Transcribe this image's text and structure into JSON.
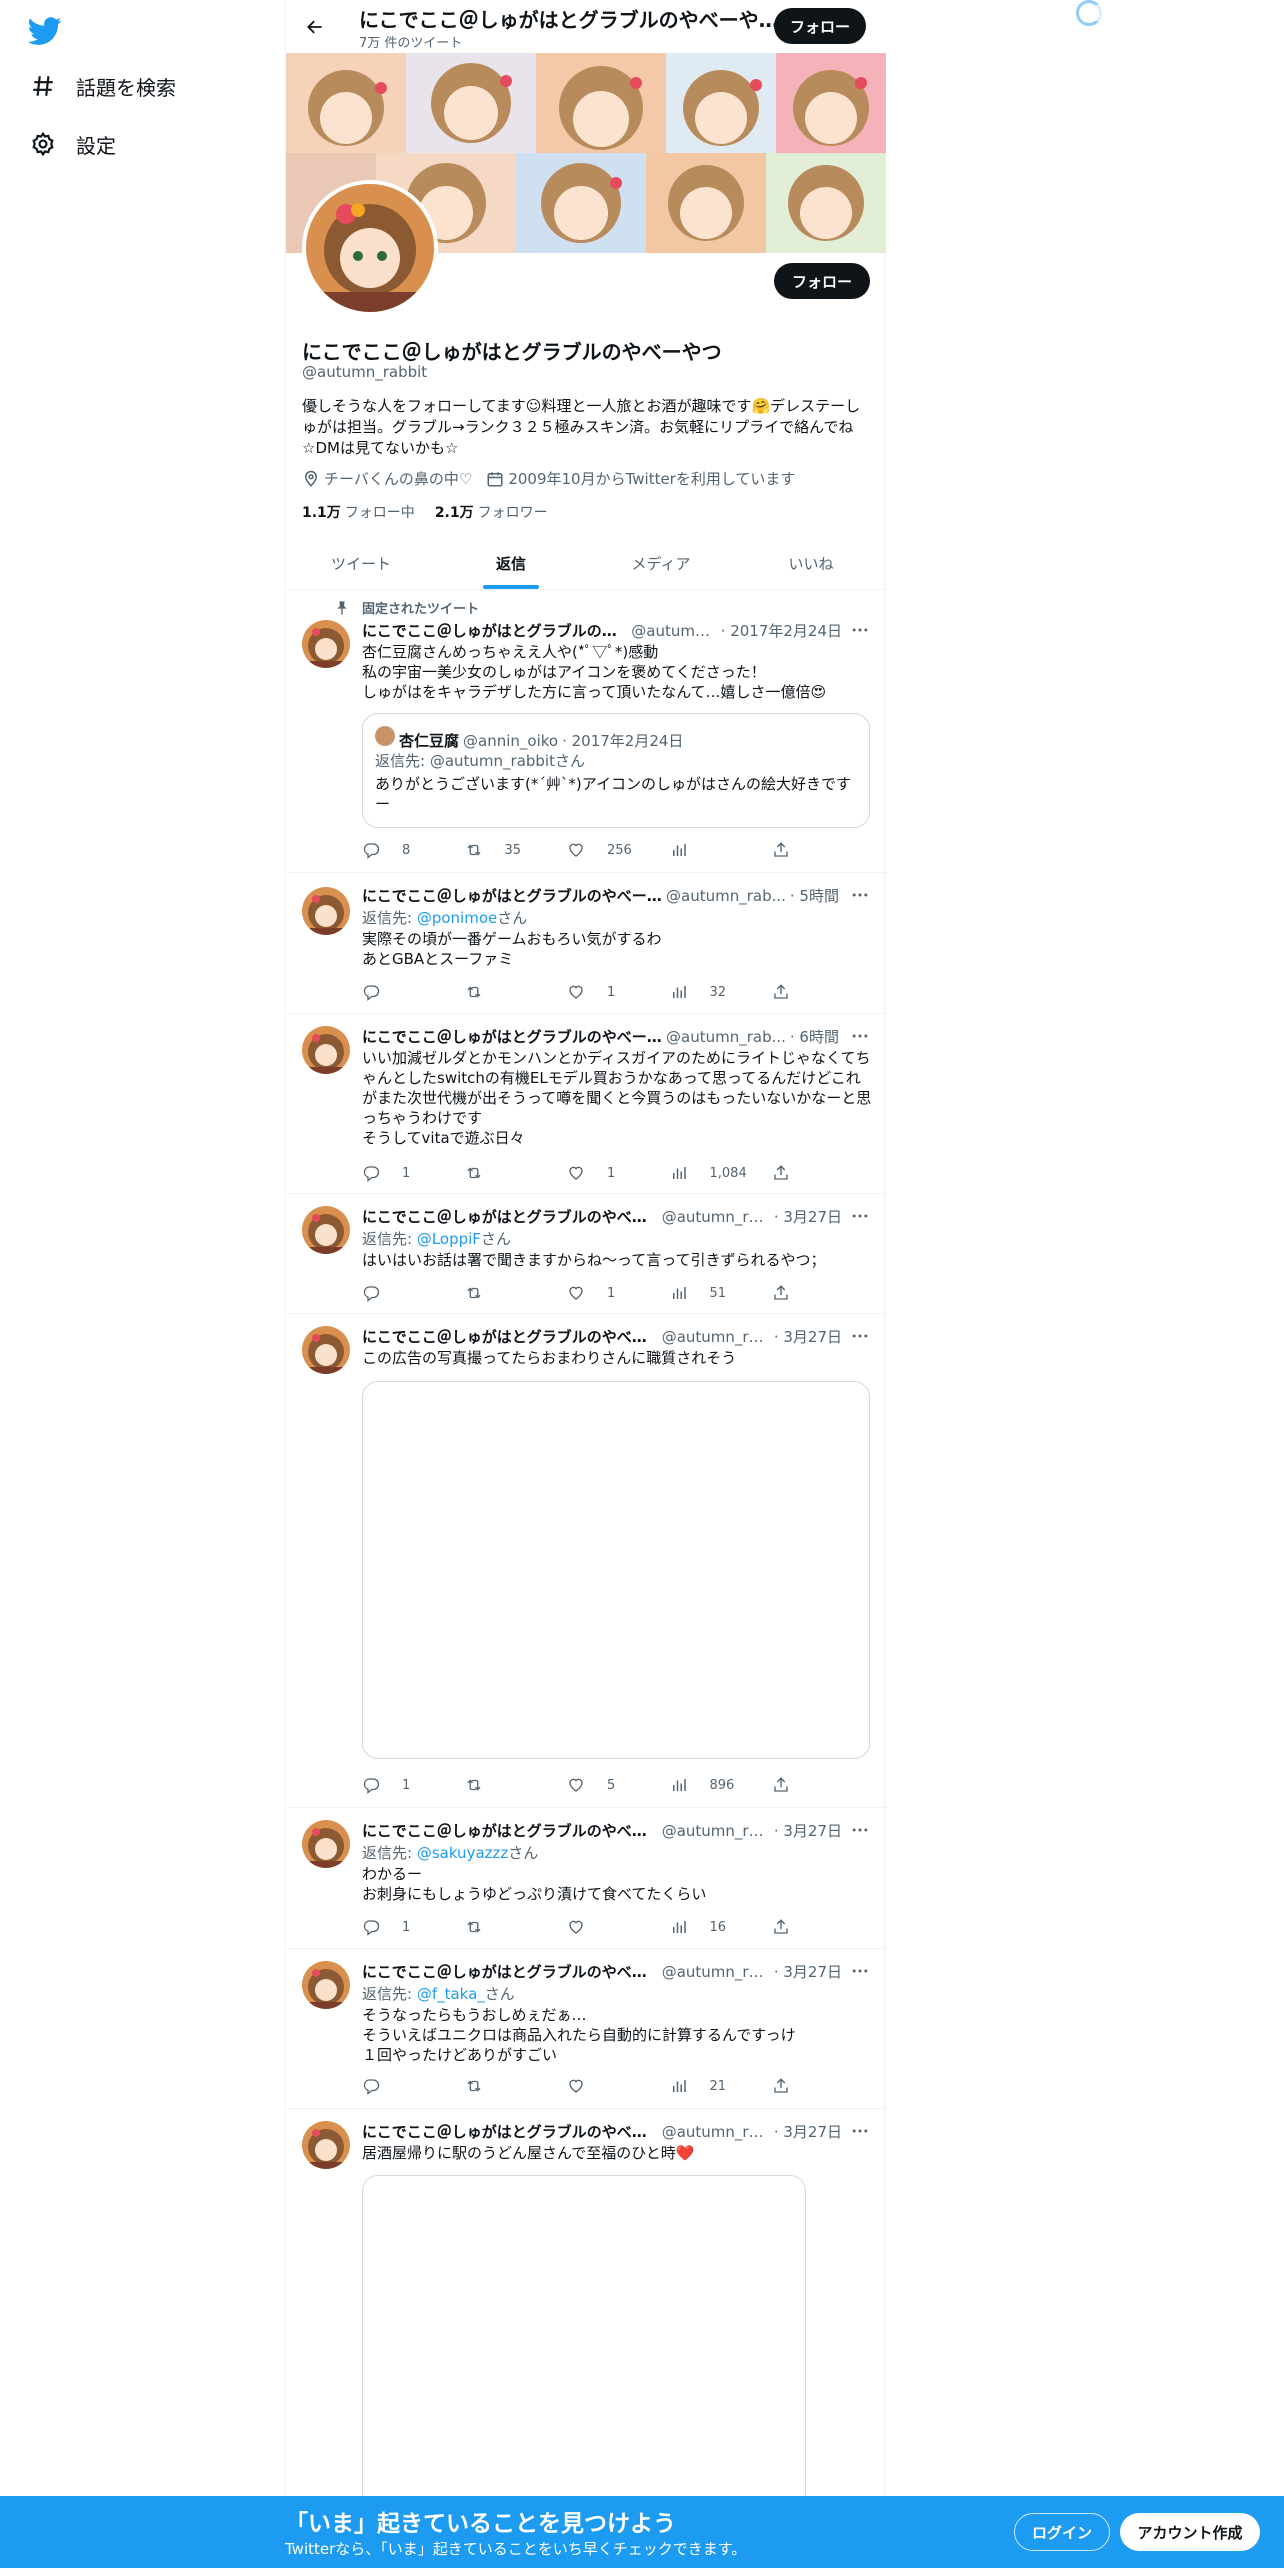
{
  "sidebar": {
    "logo_icon": "twitter-bird-icon",
    "items": [
      {
        "label": "話題を検索",
        "icon": "hashtag-icon"
      },
      {
        "label": "設定",
        "icon": "gear-icon"
      }
    ]
  },
  "header": {
    "name": "にこでここ＠しゅがはとグラブルのやべーや...",
    "tweet_count": "7万 件のツイート",
    "follow_label": "フォロー"
  },
  "profile": {
    "name": "にこでここ＠しゅがはとグラブルのやべーやつ",
    "handle": "@autumn_rabbit",
    "bio": "優しそうな人をフォローしてます☺料理と一人旅とお酒が趣味です🤗デレステーしゅがは担当。グラブル→ランク３２５極みスキン済。お気軽にリプライで絡んでね☆DMは見てないかも☆",
    "location": "チーバくんの鼻の中♡",
    "joined": "2009年10月からTwitterを利用しています",
    "following_count": "1.1万",
    "following_label": "フォロー中",
    "followers_count": "2.1万",
    "followers_label": "フォロワー",
    "follow_label": "フォロー"
  },
  "tabs": [
    {
      "label": "ツイート",
      "active": false
    },
    {
      "label": "返信",
      "active": true
    },
    {
      "label": "メディア",
      "active": false
    },
    {
      "label": "いいね",
      "active": false
    }
  ],
  "pinned_label": "固定されたツイート",
  "tweets": [
    {
      "name": "にこでここ＠しゅがはとグラブルのや...",
      "handle": "@autumn...",
      "date": "· 2017年2月24日",
      "text": "杏仁豆腐さんめっちゃええ人や(*ﾟ▽ﾟ*)感動\n私の宇宙一美少女のしゅがはアイコンを褒めてくださった！\nしゅがはをキャラデザした方に言って頂いたなんて…嬉しさ一億倍😍",
      "quote": {
        "name": "杏仁豆腐",
        "handle": "@annin_oiko",
        "date": "· 2017年2月24日",
        "reply_prefix": "返信先: ",
        "reply_to": "@autumn_rabbitさん",
        "text": "ありがとうございます(*´艸`*)アイコンのしゅがはさんの絵大好きですー"
      },
      "replies": "8",
      "retweets": "35",
      "likes": "256",
      "views": ""
    },
    {
      "name": "にこでここ＠しゅがはとグラブルのやべー...",
      "handle": "@autumn_rab...",
      "date": "· 5時間",
      "reply_prefix": "返信先: ",
      "reply_to": "@ponimoe",
      "reply_suffix": "さん",
      "text": "実際その頃が一番ゲームおもろい気がするわ\nあとGBAとスーファミ",
      "replies": "",
      "retweets": "",
      "likes": "1",
      "views": "32"
    },
    {
      "name": "にこでここ＠しゅがはとグラブルのやべー...",
      "handle": "@autumn_rab...",
      "date": "· 6時間",
      "text": "いい加減ゼルダとかモンハンとかディスガイアのためにライトじゃなくてちゃんとしたswitchの有機ELモデル買おうかなあって思ってるんだけどこれがまた次世代機が出そうって噂を聞くと今買うのはもったいないかなーと思っちゃうわけです\nそうしてvitaで遊ぶ日々",
      "replies": "1",
      "retweets": "",
      "likes": "1",
      "views": "1,084"
    },
    {
      "name": "にこでここ＠しゅがはとグラブルのやべー...",
      "handle": "@autumn_ra...",
      "date": "· 3月27日",
      "reply_prefix": "返信先: ",
      "reply_to": "@LoppiF",
      "reply_suffix": "さん",
      "text": "はいはいお話は署で聞きますからね～って言って引きずられるやつ；",
      "replies": "",
      "retweets": "",
      "likes": "1",
      "views": "51"
    },
    {
      "name": "にこでここ＠しゅがはとグラブルのやべー...",
      "handle": "@autumn_ra...",
      "date": "· 3月27日",
      "text": "この広告の写真撮ってたらおまわりさんに職質されそう",
      "replies": "1",
      "retweets": "",
      "likes": "5",
      "views": "896"
    },
    {
      "name": "にこでここ＠しゅがはとグラブルのやべー...",
      "handle": "@autumn_ra...",
      "date": "· 3月27日",
      "reply_prefix": "返信先: ",
      "reply_to": "@sakuyazzz",
      "reply_suffix": "さん",
      "text": "わかるー\nお刺身にもしょうゆどっぷり漬けて食べてたくらい",
      "replies": "1",
      "retweets": "",
      "likes": "",
      "views": "16"
    },
    {
      "name": "にこでここ＠しゅがはとグラブルのやべー...",
      "handle": "@autumn_ra...",
      "date": "· 3月27日",
      "reply_prefix": "返信先: ",
      "reply_to": "@f_taka_",
      "reply_suffix": "さん",
      "text": "そうなったらもうおしめぇだぁ…\nそういえばユニクロは商品入れたら自動的に計算するんですっけ\n１回やったけどありがすごい",
      "replies": "",
      "retweets": "",
      "likes": "",
      "views": "21"
    },
    {
      "name": "にこでここ＠しゅがはとグラブルのやべー...",
      "handle": "@autumn_ra...",
      "date": "· 3月27日",
      "text": "居酒屋帰りに駅のうどん屋さんで至福のひと時❤️"
    }
  ],
  "bottom_bar": {
    "title": "「いま」起きていることを見つけよう",
    "subtitle": "Twitterなら、「いま」起きていることをいち早くチェックできます。",
    "login_label": "ログイン",
    "signup_label": "アカウント作成"
  },
  "colors": {
    "accent": "#1d9bf0",
    "text": "#0f1419",
    "muted": "#536471",
    "border": "#eff3f4",
    "button_dark": "#0f1419"
  }
}
